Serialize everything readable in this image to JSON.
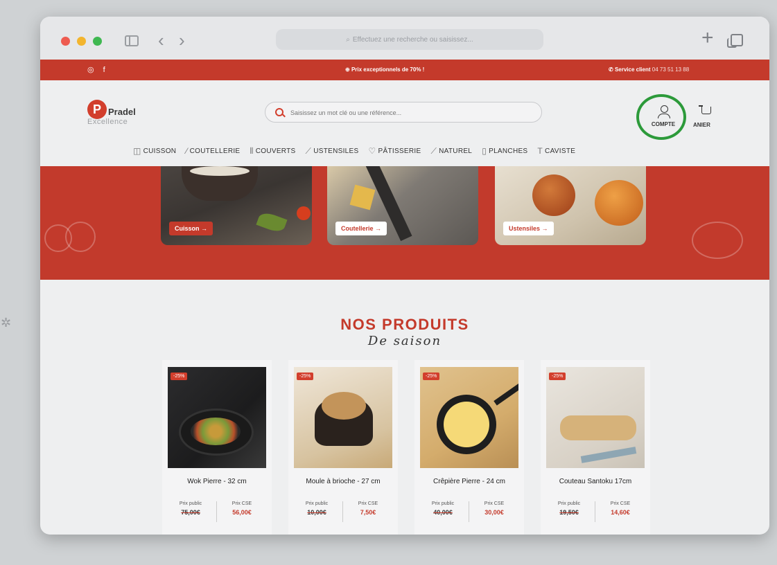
{
  "browser": {
    "url_placeholder": "Effectuez une recherche ou saisissez..."
  },
  "promo_bar": {
    "social_label": "◎ f",
    "deal_text": "Prix exceptionnels de 70% !",
    "service_label": "Service client",
    "service_phone": "04 73 51 13 88"
  },
  "header": {
    "logo_name": "Pradel",
    "logo_sub": "Excellence",
    "search_placeholder": "Saisissez un mot clé ou une référence...",
    "account_label": "COMPTE",
    "cart_label": "ANIER"
  },
  "nav": {
    "items": [
      {
        "label": "CUISSON",
        "icon": "pot-icon"
      },
      {
        "label": "COUTELLERIE",
        "icon": "knife-icon"
      },
      {
        "label": "COUVERTS",
        "icon": "cutlery-icon"
      },
      {
        "label": "USTENSILES",
        "icon": "utensil-icon"
      },
      {
        "label": "PÂTISSERIE",
        "icon": "cake-icon"
      },
      {
        "label": "NATUREL",
        "icon": "leaf-icon"
      },
      {
        "label": "PLANCHES",
        "icon": "board-icon"
      },
      {
        "label": "CAVISTE",
        "icon": "corkscrew-icon"
      }
    ]
  },
  "hero": {
    "cards": [
      {
        "label": "Cuisson →"
      },
      {
        "label": "Coutellerie →"
      },
      {
        "label": "Ustensiles →"
      }
    ]
  },
  "products_section": {
    "title": "NOS PRODUITS",
    "subtitle": "De saison",
    "public_price_label": "Prix public",
    "cse_price_label": "Prix CSE",
    "items": [
      {
        "badge": "-25%",
        "name": "Wok Pierre - 32 cm",
        "public_price": "75,00€",
        "cse_price": "56,00€"
      },
      {
        "badge": "-25%",
        "name": "Moule à brioche - 27 cm",
        "public_price": "10,00€",
        "cse_price": "7,50€"
      },
      {
        "badge": "-25%",
        "name": "Crêpière Pierre - 24 cm",
        "public_price": "40,00€",
        "cse_price": "30,00€"
      },
      {
        "badge": "-25%",
        "name": "Couteau Santoku 17cm",
        "public_price": "19,50€",
        "cse_price": "14,60€"
      }
    ]
  },
  "colors": {
    "brand_red": "#c43a2b",
    "highlight_ring": "#2c9a3a"
  }
}
